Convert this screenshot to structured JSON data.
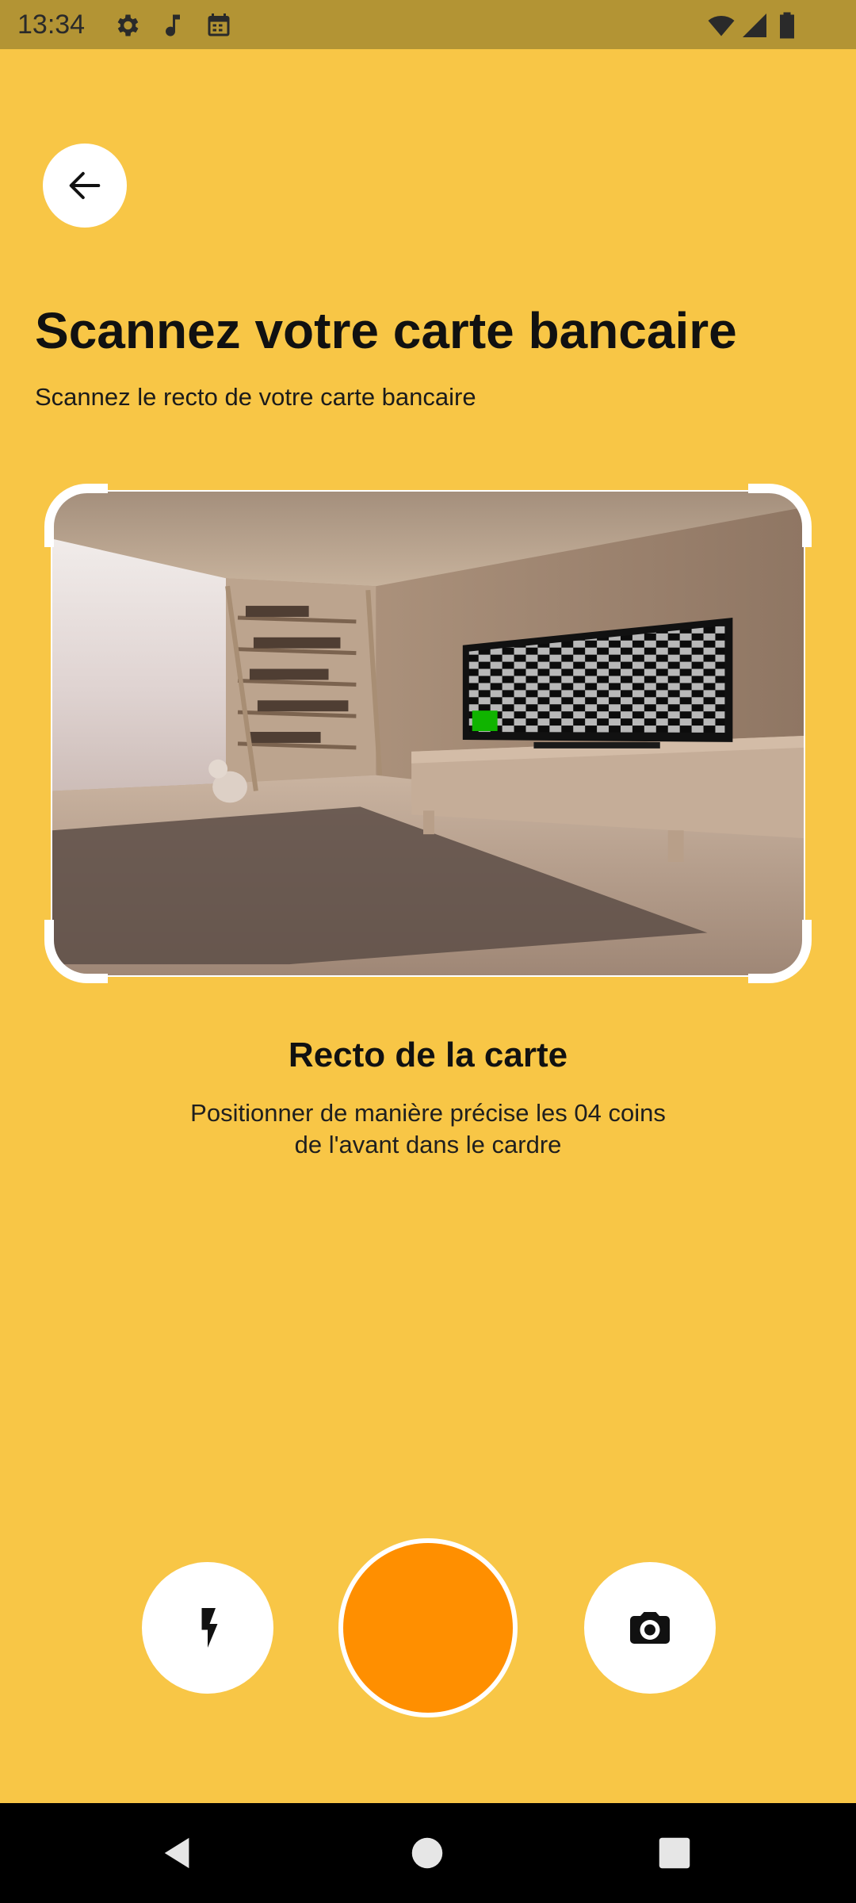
{
  "status_bar": {
    "time": "13:34",
    "left_icons": [
      "gear-icon",
      "music-note-icon",
      "calendar-icon"
    ],
    "right_icons": [
      "wifi-icon",
      "signal-icon",
      "battery-icon"
    ],
    "background": "#B39434"
  },
  "header": {
    "back_icon": "arrow-left-icon",
    "title": "Scannez votre carte bancaire",
    "subtitle": "Scannez le recto de votre carte bancaire"
  },
  "scanner": {
    "frame_color": "#FFFFFF",
    "side_title": "Recto de la carte",
    "instructions": "Positionner de manière précise les 04 coins de l'avant dans le cardre"
  },
  "controls": {
    "flash_icon": "flash-icon",
    "shutter_color": "#FF8F00",
    "switch_camera_icon": "camera-icon"
  },
  "nav_bar": {
    "buttons": [
      "back-triangle-icon",
      "home-circle-icon",
      "recents-square-icon"
    ]
  },
  "colors": {
    "background": "#F8C646",
    "accent": "#FF8F00"
  }
}
